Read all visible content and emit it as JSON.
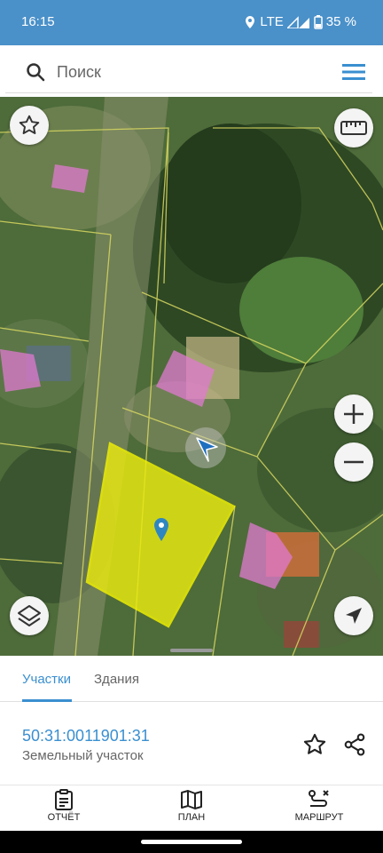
{
  "status_bar": {
    "time": "16:15",
    "network": "LTE",
    "battery": "35 %"
  },
  "search": {
    "placeholder": "Поиск",
    "icon": "search-icon",
    "menu_icon": "hamburger-menu-icon"
  },
  "map": {
    "buttons": [
      "favorites-star-icon",
      "ruler-icon",
      "zoom-in-icon",
      "zoom-out-icon",
      "layers-icon",
      "location-arrow-icon"
    ],
    "colors": {
      "selected_parcel": "#e6e600",
      "building": "#e07ad0",
      "parcel_border": "#d8d860"
    }
  },
  "tabs": {
    "parcels": "Участки",
    "buildings": "Здания"
  },
  "parcel": {
    "cadastral_number": "50:31:0011901:31",
    "type": "Земельный участок"
  },
  "bottom_nav": {
    "report": "ОТЧЁТ",
    "plan": "ПЛАН",
    "route": "МАРШРУТ"
  },
  "accent_color": "#3a8fd0"
}
